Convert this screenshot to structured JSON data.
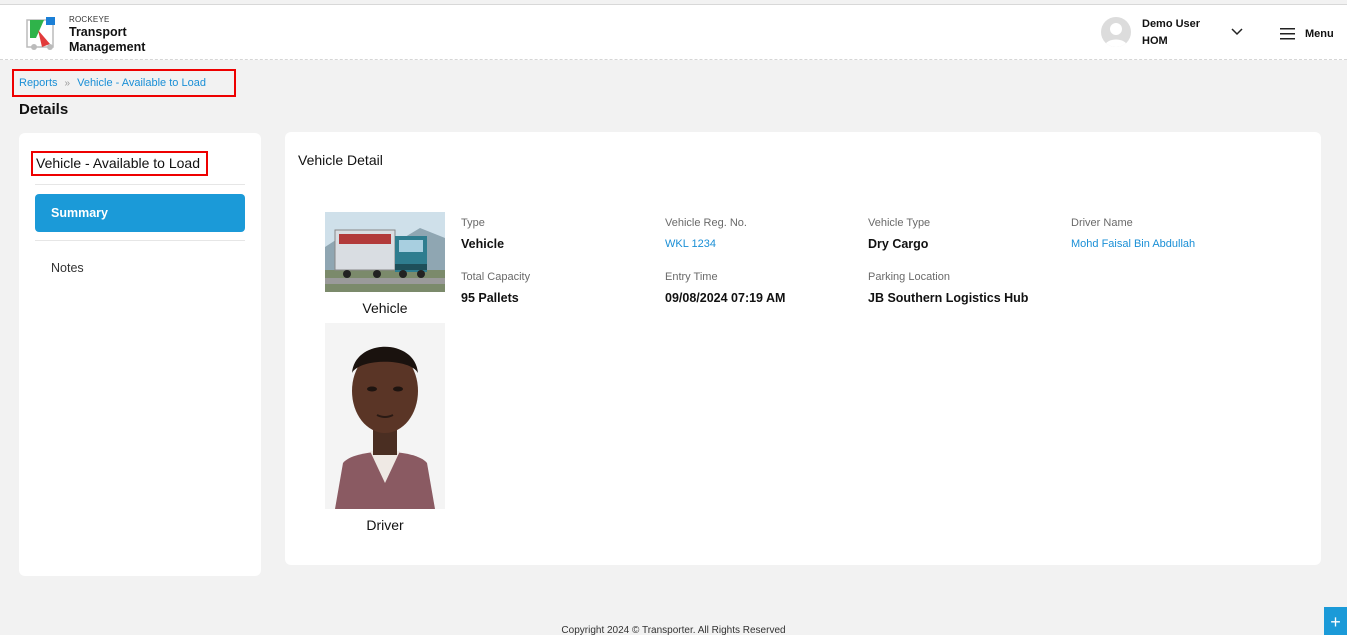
{
  "brand": {
    "small": "ROCKEYE",
    "line1": "Transport",
    "line2": "Management"
  },
  "user": {
    "name": "Demo User",
    "role": "HOM"
  },
  "menu": {
    "label": "Menu"
  },
  "breadcrumb": {
    "root": "Reports",
    "current": "Vehicle - Available to Load"
  },
  "page": {
    "title": "Details"
  },
  "left_panel": {
    "title": "Vehicle - Available to Load",
    "nav": [
      {
        "label": "Summary",
        "active": true
      },
      {
        "label": "Notes",
        "active": false
      }
    ]
  },
  "detail": {
    "section_title": "Vehicle Detail",
    "vehicle_caption": "Vehicle",
    "driver_caption": "Driver",
    "fields": [
      {
        "label": "Type",
        "value": "Vehicle"
      },
      {
        "label": "Vehicle Reg. No.",
        "value": "WKL 1234"
      },
      {
        "label": "Vehicle Type",
        "value": "Dry Cargo"
      },
      {
        "label": "Driver Name",
        "value": "Mohd Faisal Bin Abdullah"
      },
      {
        "label": "Total Capacity",
        "value": "95 Pallets"
      },
      {
        "label": "Entry Time",
        "value": "09/08/2024 07:19 AM"
      },
      {
        "label": "Parking Location",
        "value": "JB Southern Logistics Hub"
      }
    ]
  },
  "footer": {
    "text": "Copyright 2024 © Transporter. All Rights Reserved"
  },
  "fab": {
    "icon": "plus-icon"
  },
  "colors": {
    "accent": "#1b9ad8",
    "link": "#1a8fd6",
    "highlight": "#e00000"
  }
}
